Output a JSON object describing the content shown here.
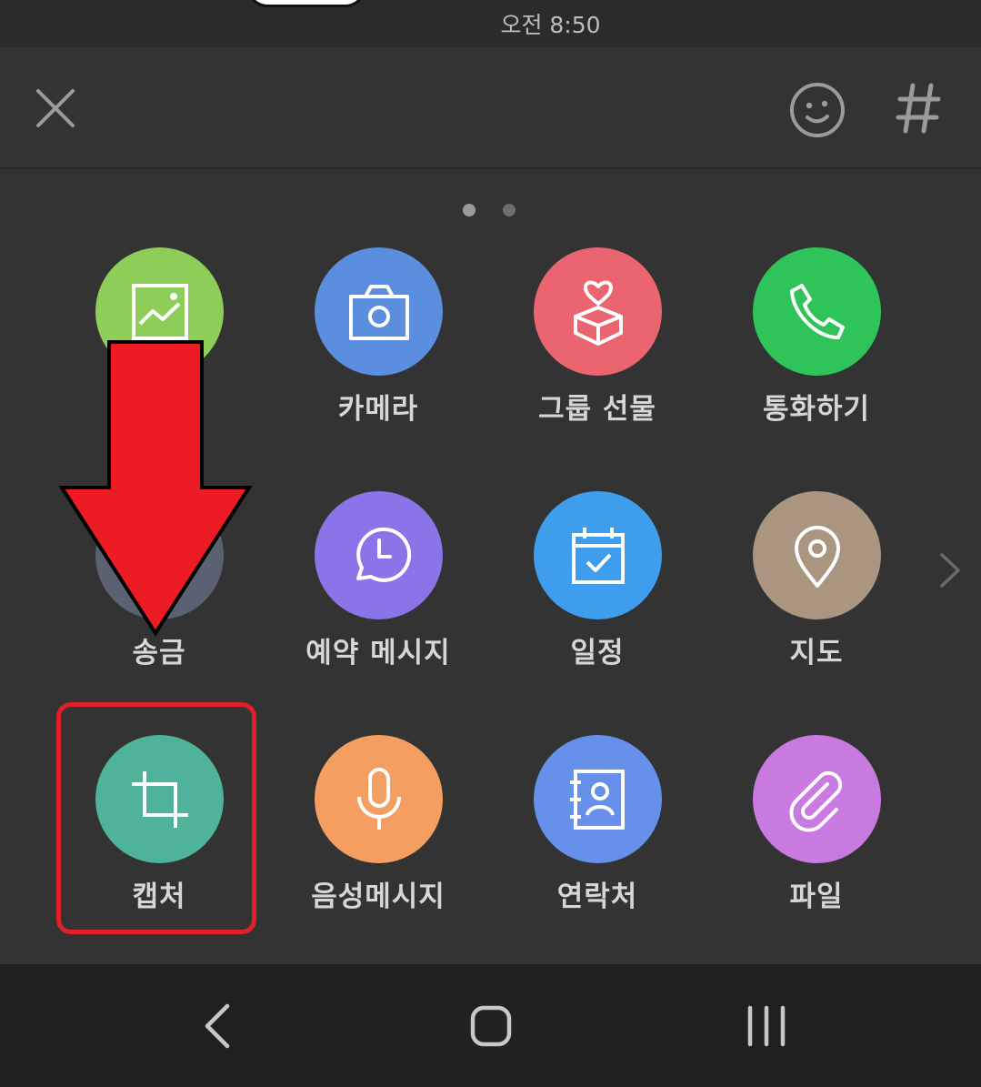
{
  "status_bar": {
    "time": "오전 8:50"
  },
  "colors": {
    "background": "#333333",
    "status_bar_bg": "#2b2b2b",
    "nav_bar_bg": "#212121",
    "icon_gray": "#9b9b9b",
    "dot_active": "#9a9a9a",
    "dot_inactive": "#6f6f6f",
    "highlight_red": "#e0202b",
    "arrow_red": "#ed1c24"
  },
  "header": {
    "close_icon": "close-icon",
    "emoji_icon": "emoticon-icon",
    "hashtag_icon": "hashtag-icon"
  },
  "pager": {
    "pages": 2,
    "current": 1
  },
  "menu": {
    "items": [
      {
        "label": "",
        "icon": "image-icon",
        "color": "#8ecd58"
      },
      {
        "label": "카메라",
        "icon": "camera-icon",
        "color": "#5b8ede"
      },
      {
        "label": "그룹 선물",
        "icon": "gift-box-icon",
        "color": "#ea6570"
      },
      {
        "label": "통화하기",
        "icon": "phone-icon",
        "color": "#2fc45a"
      },
      {
        "label": "송금",
        "icon": "money-transfer-icon",
        "color": "#5a6170"
      },
      {
        "label": "예약 메시지",
        "icon": "scheduled-message-icon",
        "color": "#8a74e8"
      },
      {
        "label": "일정",
        "icon": "calendar-check-icon",
        "color": "#3f9ded"
      },
      {
        "label": "지도",
        "icon": "map-pin-icon",
        "color": "#a99580"
      },
      {
        "label": "캡처",
        "icon": "crop-icon",
        "color": "#4fb39b"
      },
      {
        "label": "음성메시지",
        "icon": "microphone-icon",
        "color": "#f59e62"
      },
      {
        "label": "연락처",
        "icon": "contact-book-icon",
        "color": "#6690ea"
      },
      {
        "label": "파일",
        "icon": "paperclip-icon",
        "color": "#c87ae0"
      }
    ]
  },
  "navigation": {
    "back_icon": "back-icon",
    "home_icon": "home-icon",
    "recents_icon": "recents-icon"
  }
}
